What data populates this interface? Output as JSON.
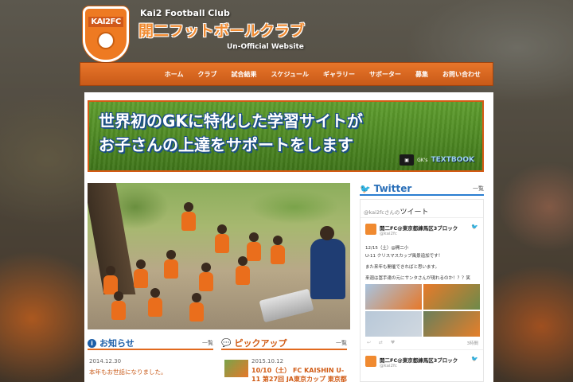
{
  "header": {
    "logo_text": "KAI2FC",
    "club_en": "Kai2 Football Club",
    "club_jp": "開二フットボールクラブ",
    "subtitle": "Un-Official Website"
  },
  "nav": {
    "items": [
      "ホーム",
      "クラブ",
      "試合結果",
      "スケジュール",
      "ギャラリー",
      "サポーター",
      "募集",
      "お問い合わせ"
    ]
  },
  "banner": {
    "line1": "世界初のGKに特化した学習サイトが",
    "line2": "お子さんの上達をサポートをします",
    "badge_pre": "GK's",
    "badge_text": "TEXTBOOK"
  },
  "news": {
    "title": "お知らせ",
    "more": "一覧",
    "date": "2014.12.30",
    "link": "本年もお世話になりました。"
  },
  "pickup": {
    "title": "ピックアップ",
    "more": "一覧",
    "date": "2015.10.12",
    "link": "10/10（土） FC KAISHIN U-11 第27回 JA東京カップ 東京都"
  },
  "twitter": {
    "title": "Twitter",
    "more": "一覧",
    "feed_title": "ツイート",
    "feed_handle_prefix": "@kai2fcさんの",
    "tweet1": {
      "name": "開二FC@東京都練馬区3ブロック",
      "handle": "@kai2fc",
      "lines": [
        "12/15（土）@開二小",
        "U-11 クリスマスカップ風景追加です！",
        "また来年も開催できればと思います。",
        "来週は冨手達の元にサンタさんが現れるのか！？？笑"
      ],
      "time": "3時間"
    },
    "tweet2": {
      "name": "開二FC@東京都練馬区3ブロック",
      "handle": "@kai2fc"
    }
  },
  "colors": {
    "accent": "#e1691d",
    "nav_bg": "#d86620",
    "twitter_blue": "#2a6fb8"
  }
}
